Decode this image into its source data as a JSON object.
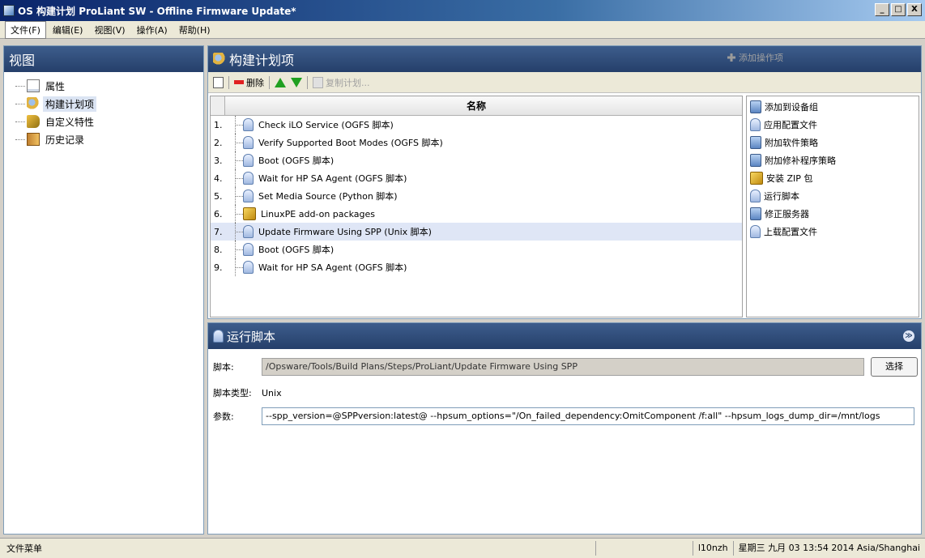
{
  "window": {
    "title": "OS 构建计划 ProLiant SW - Offline Firmware Update*",
    "buttons": [
      "_",
      "□",
      "X"
    ]
  },
  "menu": [
    "文件(F)",
    "编辑(E)",
    "视图(V)",
    "操作(A)",
    "帮助(H)"
  ],
  "left": {
    "header": "视图",
    "items": [
      {
        "label": "属性",
        "icon": "document-icon"
      },
      {
        "label": "构建计划项",
        "icon": "gear-icon",
        "selected": true
      },
      {
        "label": "自定义特性",
        "icon": "tag-icon"
      },
      {
        "label": "历史记录",
        "icon": "history-icon"
      }
    ]
  },
  "plan": {
    "header": "构建计划项",
    "toolbar": {
      "delete": "删除",
      "copy_plan": "复制计划...",
      "add_operation": "添加操作项"
    },
    "column": "名称",
    "steps": [
      {
        "num": "1.",
        "label": "Check iLO Service (OGFS 脚本)",
        "icon": "script-icon"
      },
      {
        "num": "2.",
        "label": "Verify Supported Boot Modes (OGFS 脚本)",
        "icon": "script-icon"
      },
      {
        "num": "3.",
        "label": "Boot (OGFS 脚本)",
        "icon": "script-icon"
      },
      {
        "num": "4.",
        "label": "Wait for HP SA Agent (OGFS 脚本)",
        "icon": "script-icon"
      },
      {
        "num": "5.",
        "label": "Set Media Source (Python 脚本)",
        "icon": "script-icon"
      },
      {
        "num": "6.",
        "label": "LinuxPE add-on packages",
        "icon": "zip-icon"
      },
      {
        "num": "7.",
        "label": "Update Firmware Using SPP (Unix 脚本)",
        "icon": "script-icon",
        "selected": true
      },
      {
        "num": "8.",
        "label": "Boot (OGFS 脚本)",
        "icon": "script-icon"
      },
      {
        "num": "9.",
        "label": "Wait for HP SA Agent (OGFS 脚本)",
        "icon": "script-icon"
      }
    ],
    "operations": [
      {
        "label": "添加到设备组",
        "icon": "server-group-icon"
      },
      {
        "label": "应用配置文件",
        "icon": "config-file-icon"
      },
      {
        "label": "附加软件策略",
        "icon": "software-policy-icon"
      },
      {
        "label": "附加修补程序策略",
        "icon": "patch-policy-icon"
      },
      {
        "label": "安装 ZIP 包",
        "icon": "zip-icon"
      },
      {
        "label": "运行脚本",
        "icon": "script-icon"
      },
      {
        "label": "修正服务器",
        "icon": "remediate-icon"
      },
      {
        "label": "上载配置文件",
        "icon": "upload-config-icon"
      }
    ]
  },
  "run": {
    "header": "运行脚本",
    "script_label": "脚本:",
    "script_path": "/Opsware/Tools/Build Plans/Steps/ProLiant/Update Firmware Using SPP",
    "choose": "选择",
    "type_label": "脚本类型:",
    "type_value": "Unix",
    "params_label": "参数:",
    "params_value": "--spp_version=@SPPversion:latest@ --hpsum_options=\"/On_failed_dependency:OmitComponent /f:all\" --hpsum_logs_dump_dir=/mnt/logs"
  },
  "status": {
    "left": "文件菜单",
    "user": "l10nzh",
    "datetime": "星期三 九月 03 13:54 2014 Asia/Shanghai"
  }
}
